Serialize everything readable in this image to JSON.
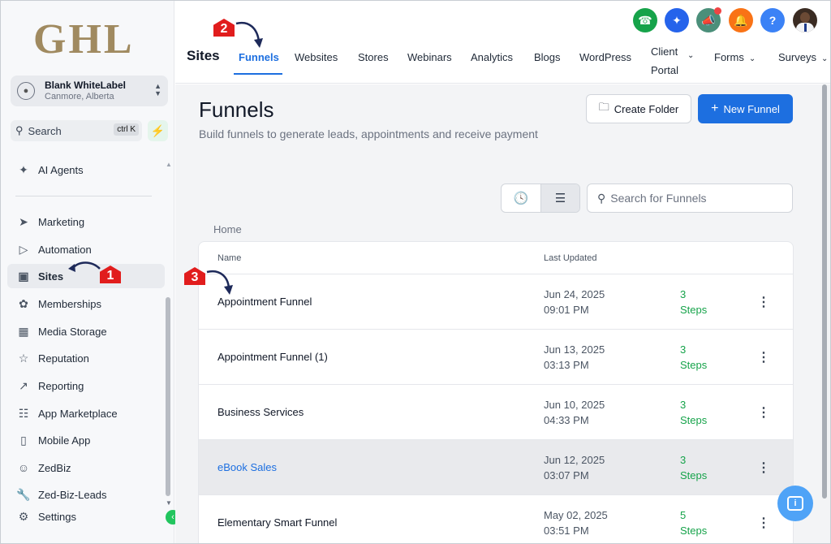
{
  "logo": "GHL",
  "account": {
    "name": "Blank WhiteLabel",
    "location": "Canmore, Alberta"
  },
  "sidebar_search": {
    "label": "Search",
    "shortcut": "ctrl K"
  },
  "sidebar": {
    "items": [
      {
        "label": "AI Agents",
        "icon": "sparkle-icon"
      },
      {
        "label": "Marketing",
        "icon": "send-icon"
      },
      {
        "label": "Automation",
        "icon": "automation-icon"
      },
      {
        "label": "Sites",
        "icon": "globe-icon"
      },
      {
        "label": "Memberships",
        "icon": "badge-icon"
      },
      {
        "label": "Media Storage",
        "icon": "image-icon"
      },
      {
        "label": "Reputation",
        "icon": "star-icon"
      },
      {
        "label": "Reporting",
        "icon": "trend-icon"
      },
      {
        "label": "App Marketplace",
        "icon": "grid-icon"
      },
      {
        "label": "Mobile App",
        "icon": "phone-icon"
      },
      {
        "label": "ZedBiz",
        "icon": "chat-icon"
      },
      {
        "label": "Zed-Biz-Leads",
        "icon": "wrench-icon"
      },
      {
        "label": "Settings",
        "icon": "gear-icon"
      }
    ]
  },
  "header": {
    "title": "Sites",
    "tabs": [
      {
        "label": "Funnels"
      },
      {
        "label": "Websites"
      },
      {
        "label": "Stores"
      },
      {
        "label": "Webinars"
      },
      {
        "label": "Analytics"
      },
      {
        "label": "Blogs"
      },
      {
        "label": "WordPress"
      },
      {
        "label": "Client",
        "label2": "Portal"
      },
      {
        "label": "Forms"
      },
      {
        "label": "Surveys"
      }
    ]
  },
  "colors": {
    "accent": "#1d6fe0",
    "steps": "#16a34a",
    "annotation": "#e11d1d"
  },
  "page": {
    "title": "Funnels",
    "subtitle": "Build funnels to generate leads, appointments and receive payment",
    "create_folder": "Create Folder",
    "new_funnel": "New Funnel",
    "search_placeholder": "Search for Funnels",
    "breadcrumb": "Home"
  },
  "table": {
    "headers": {
      "name": "Name",
      "updated": "Last Updated"
    },
    "rows": [
      {
        "name": "Appointment Funnel",
        "date": "Jun 24, 2025",
        "time": "09:01 PM",
        "steps_n": "3",
        "steps_w": "Steps"
      },
      {
        "name": "Appointment Funnel (1)",
        "date": "Jun 13, 2025",
        "time": "03:13 PM",
        "steps_n": "3",
        "steps_w": "Steps"
      },
      {
        "name": "Business Services",
        "date": "Jun 10, 2025",
        "time": "04:33 PM",
        "steps_n": "3",
        "steps_w": "Steps"
      },
      {
        "name": "eBook Sales",
        "date": "Jun 12, 2025",
        "time": "03:07 PM",
        "steps_n": "3",
        "steps_w": "Steps"
      },
      {
        "name": "Elementary Smart Funnel",
        "date": "May 02, 2025",
        "time": "03:51 PM",
        "steps_n": "5",
        "steps_w": "Steps"
      }
    ]
  },
  "annotations": [
    "1",
    "2",
    "3"
  ]
}
